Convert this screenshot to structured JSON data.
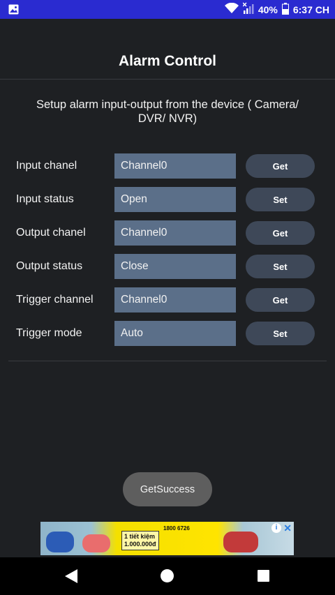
{
  "status_bar": {
    "battery": "40%",
    "time": "6:37 CH"
  },
  "header": {
    "title": "Alarm Control"
  },
  "description": "Setup alarm input-output from the device ( Camera/ DVR/ NVR)",
  "rows": [
    {
      "label": "Input chanel",
      "value": "Channel0",
      "button": "Get"
    },
    {
      "label": "Input status",
      "value": "Open",
      "button": "Set"
    },
    {
      "label": "Output chanel",
      "value": "Channel0",
      "button": "Get"
    },
    {
      "label": "Output status",
      "value": "Close",
      "button": "Set"
    },
    {
      "label": "Trigger channel",
      "value": "Channel0",
      "button": "Get"
    },
    {
      "label": "Trigger mode",
      "value": "Auto",
      "button": "Set"
    }
  ],
  "toast": "GetSuccess",
  "ad": {
    "tag_line1": "1 tiết kiệm",
    "tag_line2": "1.000.000đ",
    "phone": "1800 6726"
  }
}
